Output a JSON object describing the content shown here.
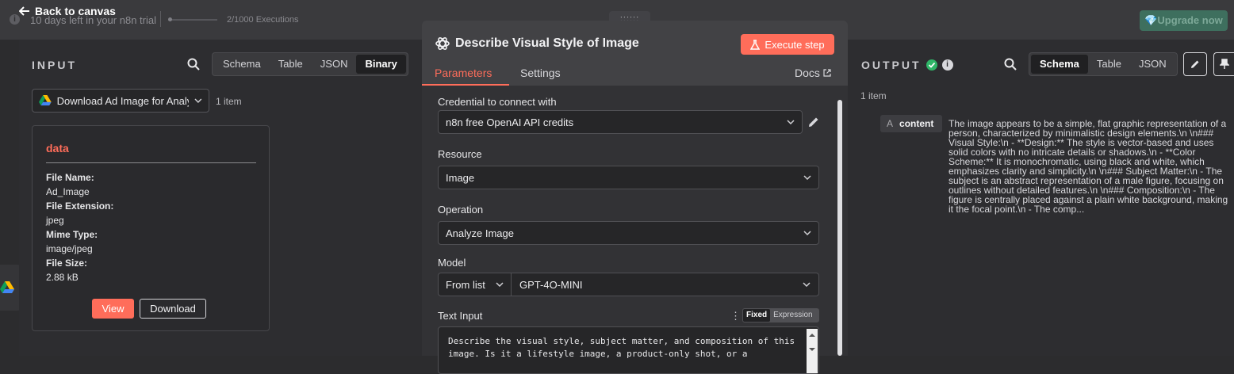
{
  "topbar": {
    "back_label": "Back to canvas",
    "trial_text": "10 days left in your n8n trial",
    "executions": "2/1000 Executions",
    "upgrade_label": "Upgrade now",
    "upgrade_icon": "gem-icon"
  },
  "input": {
    "title": "INPUT",
    "tabs": [
      "Schema",
      "Table",
      "JSON",
      "Binary"
    ],
    "active_tab": "Binary",
    "node_select": "Download Ad Image for Analysis",
    "item_count": "1 item",
    "binary": {
      "title": "data",
      "file_name_label": "File Name:",
      "file_name": "Ad_Image",
      "file_ext_label": "File Extension:",
      "file_ext": "jpeg",
      "mime_label": "Mime Type:",
      "mime": "image/jpeg",
      "size_label": "File Size:",
      "size": "2.88 kB",
      "view_label": "View",
      "download_label": "Download"
    }
  },
  "node": {
    "title": "Describe Visual Style of Image",
    "execute_label": "Execute step",
    "tabs": {
      "parameters": "Parameters",
      "settings": "Settings"
    },
    "docs_label": "Docs",
    "credential_label": "Credential to connect with",
    "credential_value": "n8n free OpenAI API credits",
    "resource_label": "Resource",
    "resource_value": "Image",
    "operation_label": "Operation",
    "operation_value": "Analyze Image",
    "model_label": "Model",
    "model_mode": "From list",
    "model_value": "GPT-4O-MINI",
    "text_input_label": "Text Input",
    "toggle": {
      "fixed": "Fixed",
      "expression": "Expression"
    },
    "text_input_value": "Describe the visual style, subject matter, and composition of this image. Is it a lifestyle image, a product-only shot, or a"
  },
  "output": {
    "title": "OUTPUT",
    "tabs": [
      "Schema",
      "Table",
      "JSON"
    ],
    "active_tab": "Schema",
    "item_count": "1 item",
    "field_type": "A",
    "field_name": "content",
    "field_value": "The image appears to be a simple, flat graphic representation of a person, characterized by minimalistic design elements.\\n \\n### Visual Style:\\n - **Design:** The style is vector-based and uses solid colors with no intricate details or shadows.\\n - **Color Scheme:** It is monochromatic, using black and white, which emphasizes clarity and simplicity.\\n \\n### Subject Matter:\\n - The subject is an abstract representation of a male figure, focusing on outlines without detailed features.\\n \\n### Composition:\\n - The figure is centrally placed against a plain white background, making it the focal point.\\n - The comp..."
  },
  "colors": {
    "accent": "#ff6d5a",
    "success": "#2fb567",
    "panel": "#2d2d30",
    "node_panel": "#424245"
  }
}
